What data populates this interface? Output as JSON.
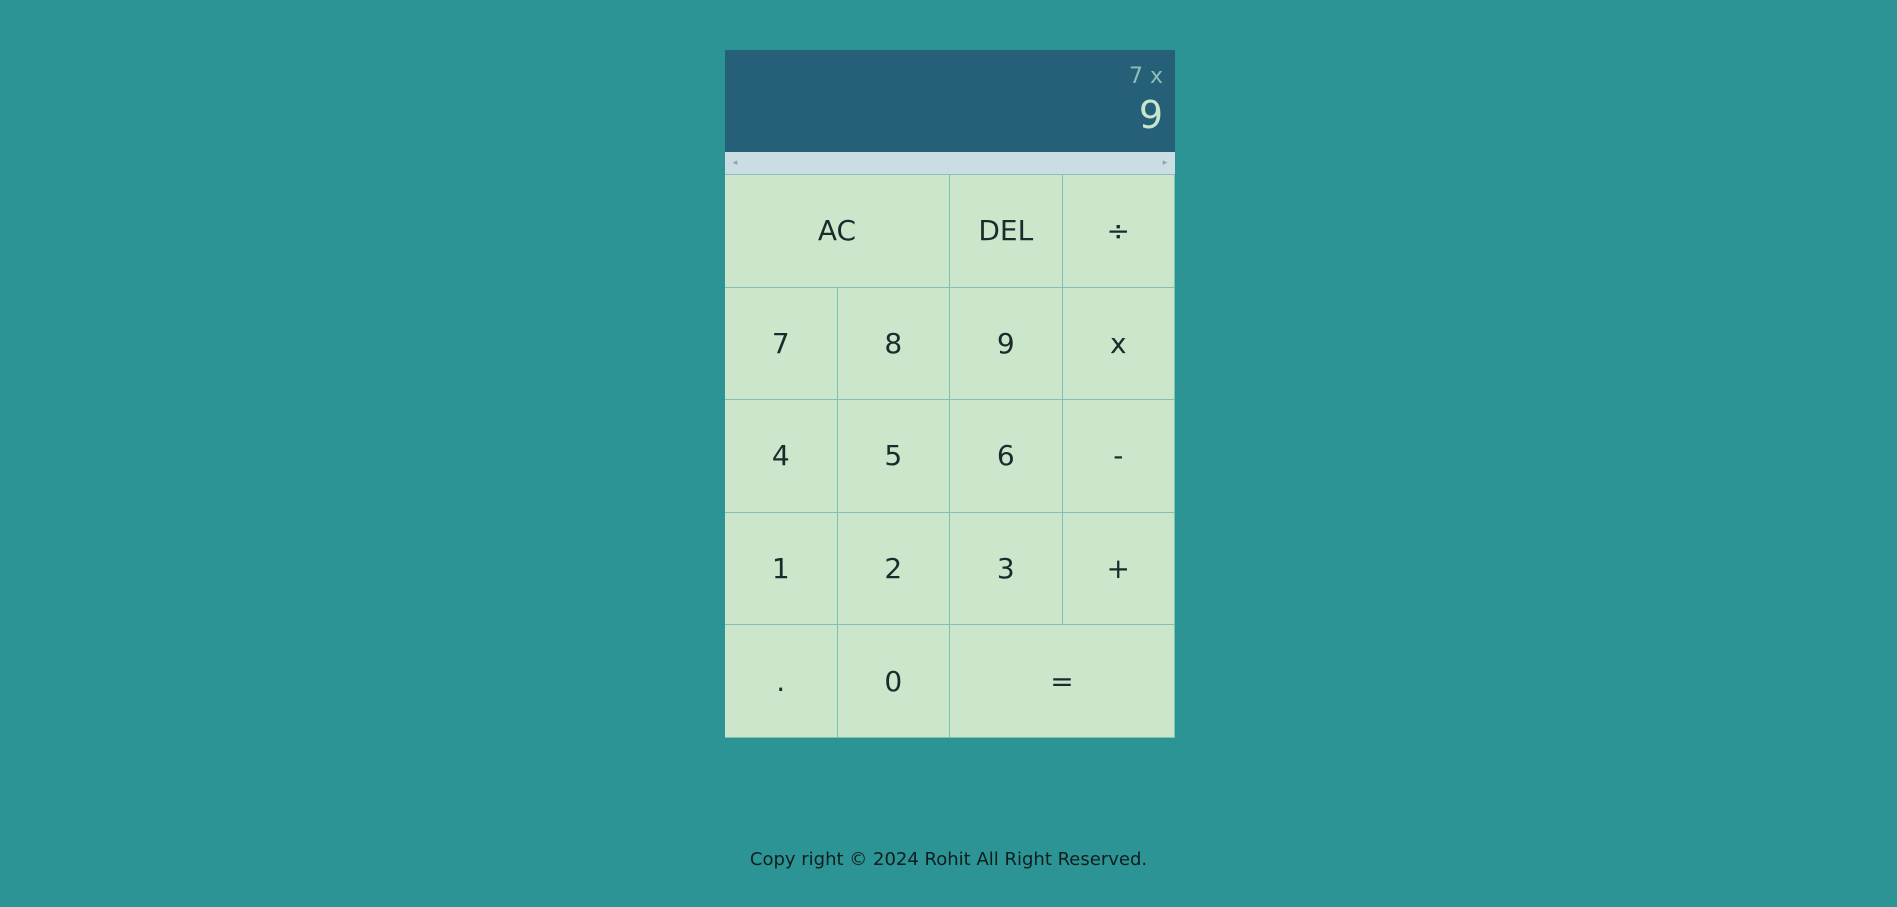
{
  "display": {
    "previous_operand": "7 x",
    "current_operand": "9"
  },
  "scrollbar": {
    "left_arrow": "◂",
    "right_arrow": "▸"
  },
  "keys": {
    "ac": "AC",
    "del": "DEL",
    "divide": "÷",
    "seven": "7",
    "eight": "8",
    "nine": "9",
    "multiply": "x",
    "four": "4",
    "five": "5",
    "six": "6",
    "minus": "-",
    "one": "1",
    "two": "2",
    "three": "3",
    "plus": "+",
    "decimal": ".",
    "zero": "0",
    "equals": "="
  },
  "footer": {
    "text": "Copy right © 2024 Rohit All Right Reserved."
  },
  "colors": {
    "background": "#2c9494",
    "display_background": "#265f78",
    "key_background": "#cce6cc",
    "key_border": "#7fc2b4"
  }
}
